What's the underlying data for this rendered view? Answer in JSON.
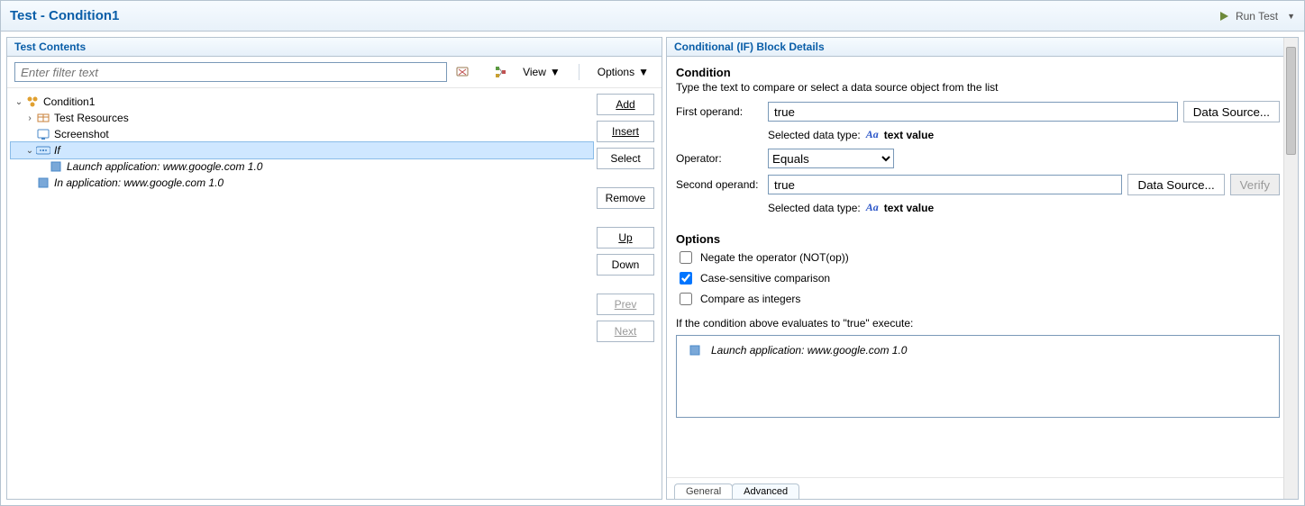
{
  "title": "Test - Condition1",
  "toolbar": {
    "run_test": "Run Test"
  },
  "left": {
    "header": "Test Contents",
    "filter_placeholder": "Enter filter text",
    "view_label": "View",
    "options_label": "Options",
    "tree": {
      "root": "Condition1",
      "test_resources": "Test Resources",
      "screenshot": "Screenshot",
      "if": "If",
      "launch": "Launch application: www.google.com  1.0",
      "in_app": "In application: www.google.com  1.0"
    },
    "buttons": {
      "add": "Add",
      "insert": "Insert",
      "select": "Select",
      "remove": "Remove",
      "up": "Up",
      "down": "Down",
      "prev": "Prev",
      "next": "Next"
    }
  },
  "right": {
    "header": "Conditional (IF) Block Details",
    "section_condition": "Condition",
    "hint": "Type the text to compare or select a data source object from the list",
    "first_operand_label": "First operand:",
    "first_operand_value": "true",
    "datasource_btn": "Data Source...",
    "verify_btn": "Verify",
    "selected_dt_label": "Selected data type:",
    "dt_value": "text value",
    "operator_label": "Operator:",
    "operator_value": "Equals",
    "second_operand_label": "Second operand:",
    "second_operand_value": "true",
    "section_options": "Options",
    "opt_negate": "Negate the operator (NOT(op))",
    "opt_case": "Case-sensitive comparison",
    "opt_int": "Compare as integers",
    "iftrue_label": "If the condition above evaluates to \"true\" execute:",
    "exec_item": "Launch application: www.google.com  1.0",
    "tabs": {
      "general": "General",
      "advanced": "Advanced"
    }
  }
}
